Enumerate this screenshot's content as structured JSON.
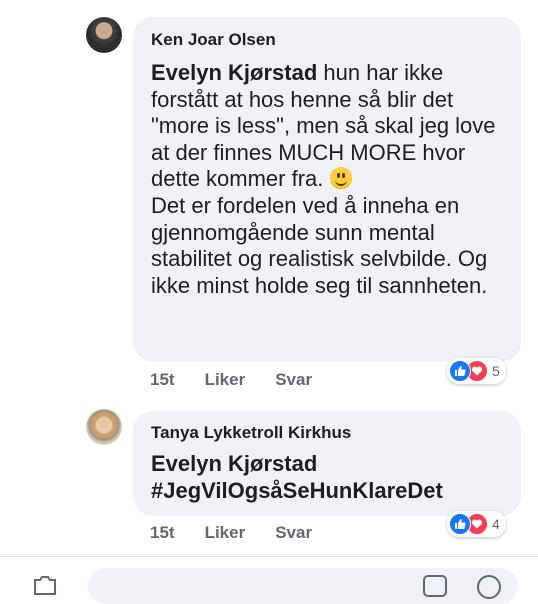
{
  "comments": [
    {
      "author": "Ken Joar Olsen",
      "mention": "Evelyn Kjørstad",
      "text_before_emoji": " hun har ikke forstått at hos henne så blir det \"more is less\", men så skal jeg love at der finnes MUCH MORE hvor dette kommer fra. ",
      "text_after_emoji": "Det er fordelen ved å inneha en gjennomgående sunn mental stabilitet og realistisk selvbilde. Og ikke minst holde seg til sannheten.",
      "emoji": "slightly-smiling-face-icon",
      "time": "15t",
      "like_label": "Liker",
      "reply_label": "Svar",
      "reaction_count": "5"
    },
    {
      "author": "Tanya Lykketroll Kirkhus",
      "mention": "Evelyn Kjørstad",
      "text": "#JegVilOgsåSeHunKlareDet",
      "time": "15t",
      "like_label": "Liker",
      "reply_label": "Svar",
      "reaction_count": "4"
    }
  ],
  "colors": {
    "bubble": "#f0f2f5",
    "like": "#1877f2",
    "love": "#f33e58",
    "meta": "#65676b"
  }
}
